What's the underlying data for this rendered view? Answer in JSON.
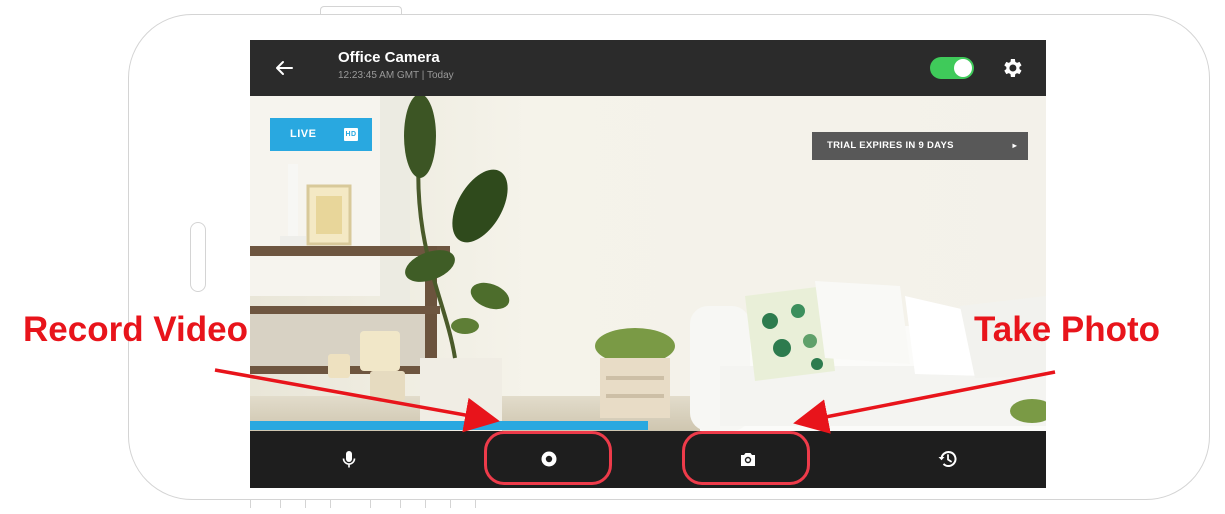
{
  "camera": {
    "title": "Office Camera",
    "subtitle": "12:23:45 AM GMT  |  Today",
    "power_on": true
  },
  "overlay": {
    "live_label": "LIVE",
    "hd_label": "HD",
    "trial_label": "TRIAL EXPIRES IN 9 DAYS",
    "trial_arrow": "▸"
  },
  "playback": {
    "buffer_progress": 0.5
  },
  "controls": {
    "items": [
      {
        "name": "microphone-icon"
      },
      {
        "name": "record-icon"
      },
      {
        "name": "camera-icon"
      },
      {
        "name": "history-icon"
      }
    ]
  },
  "annotations": {
    "record_label": "Record Video",
    "photo_label": "Take Photo",
    "color": "#e8141b"
  },
  "colors": {
    "accent_blue": "#29a8e0",
    "toggle_green": "#3fca5a",
    "bar_dark": "#2b2b2b"
  }
}
